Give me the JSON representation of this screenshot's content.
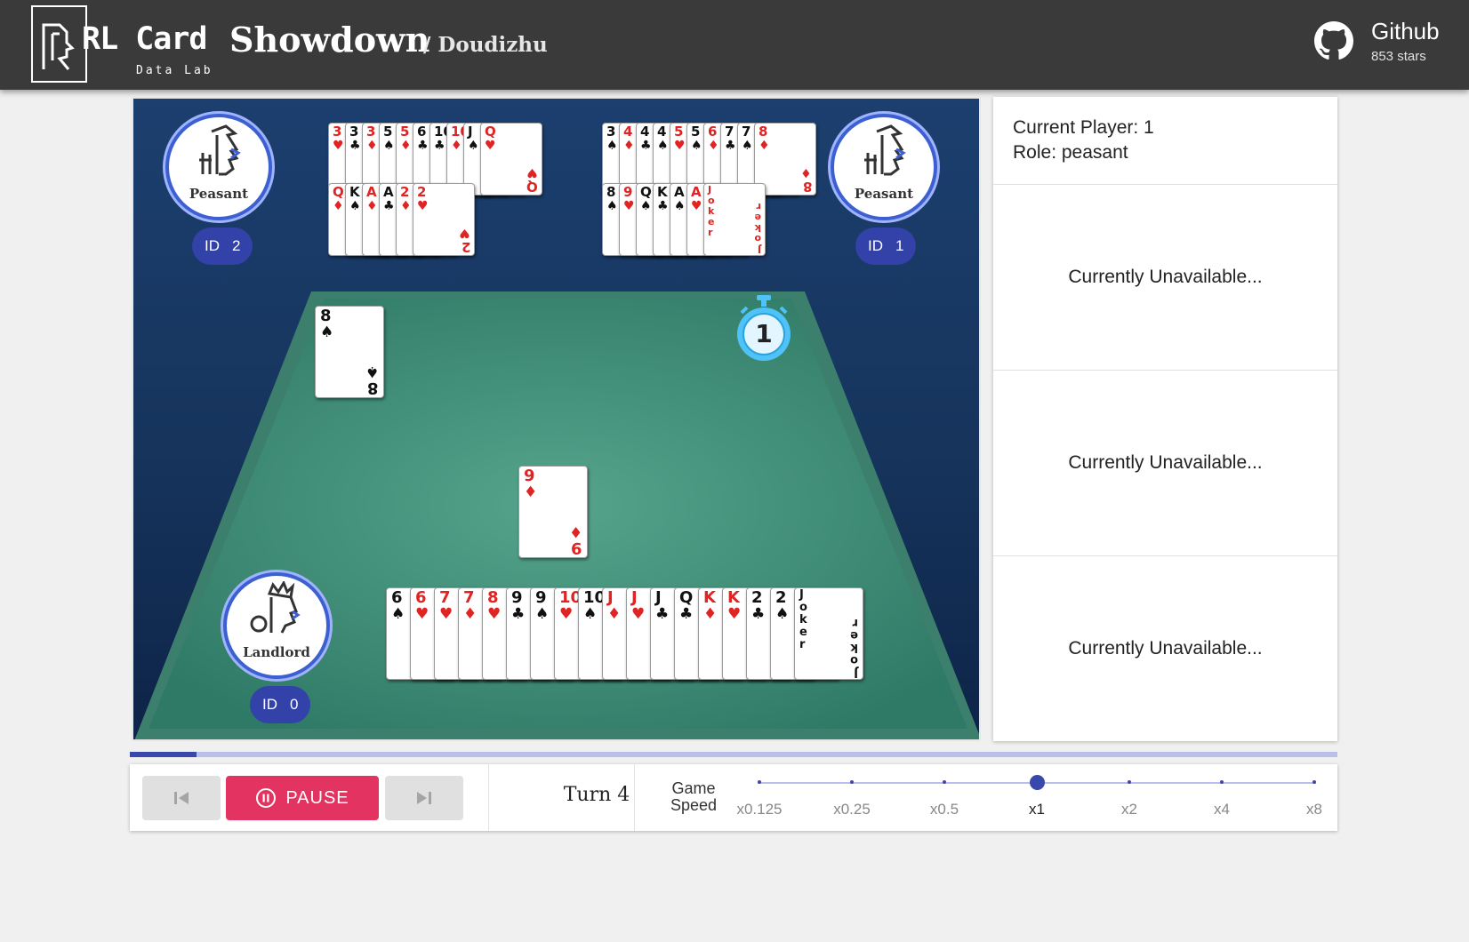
{
  "header": {
    "brand_title": "RL Card",
    "brand_word": "Showdown",
    "brand_sub": "Data Lab",
    "game_name": "/ Doudizhu",
    "github_label": "Github",
    "github_stars": "853 stars"
  },
  "players": [
    {
      "role": "Peasant",
      "id_prefix": "ID",
      "id": "2"
    },
    {
      "role": "Peasant",
      "id_prefix": "ID",
      "id": "1"
    },
    {
      "role": "Landlord",
      "id_prefix": "ID",
      "id": "0"
    }
  ],
  "timer": {
    "value": "1"
  },
  "hands": {
    "player2_row1": [
      {
        "rank": "3",
        "suit": "♥",
        "color": "red"
      },
      {
        "rank": "3",
        "suit": "♣",
        "color": "black"
      },
      {
        "rank": "3",
        "suit": "♦",
        "color": "red"
      },
      {
        "rank": "5",
        "suit": "♠",
        "color": "black"
      },
      {
        "rank": "5",
        "suit": "♦",
        "color": "red"
      },
      {
        "rank": "6",
        "suit": "♣",
        "color": "black"
      },
      {
        "rank": "10",
        "suit": "♣",
        "color": "black"
      },
      {
        "rank": "10",
        "suit": "♦",
        "color": "red"
      },
      {
        "rank": "J",
        "suit": "♠",
        "color": "black"
      },
      {
        "rank": "Q",
        "suit": "♥",
        "color": "red"
      }
    ],
    "player2_row2": [
      {
        "rank": "Q",
        "suit": "♦",
        "color": "red"
      },
      {
        "rank": "K",
        "suit": "♠",
        "color": "black"
      },
      {
        "rank": "A",
        "suit": "♦",
        "color": "red"
      },
      {
        "rank": "A",
        "suit": "♣",
        "color": "black"
      },
      {
        "rank": "2",
        "suit": "♦",
        "color": "red"
      },
      {
        "rank": "2",
        "suit": "♥",
        "color": "red"
      }
    ],
    "player1_row1": [
      {
        "rank": "3",
        "suit": "♠",
        "color": "black"
      },
      {
        "rank": "4",
        "suit": "♦",
        "color": "red"
      },
      {
        "rank": "4",
        "suit": "♣",
        "color": "black"
      },
      {
        "rank": "4",
        "suit": "♠",
        "color": "black"
      },
      {
        "rank": "5",
        "suit": "♥",
        "color": "red"
      },
      {
        "rank": "5",
        "suit": "♠",
        "color": "black"
      },
      {
        "rank": "6",
        "suit": "♦",
        "color": "red"
      },
      {
        "rank": "7",
        "suit": "♣",
        "color": "black"
      },
      {
        "rank": "7",
        "suit": "♠",
        "color": "black"
      },
      {
        "rank": "8",
        "suit": "♦",
        "color": "red"
      }
    ],
    "player1_row2": [
      {
        "rank": "8",
        "suit": "♠",
        "color": "black"
      },
      {
        "rank": "9",
        "suit": "♥",
        "color": "red"
      },
      {
        "rank": "Q",
        "suit": "♠",
        "color": "black"
      },
      {
        "rank": "K",
        "suit": "♣",
        "color": "black"
      },
      {
        "rank": "A",
        "suit": "♠",
        "color": "black"
      },
      {
        "rank": "A",
        "suit": "♥",
        "color": "red"
      },
      {
        "rank": "Joker",
        "suit": "",
        "color": "red",
        "joker": true
      }
    ],
    "player0": [
      {
        "rank": "6",
        "suit": "♠",
        "color": "black"
      },
      {
        "rank": "6",
        "suit": "♥",
        "color": "red"
      },
      {
        "rank": "7",
        "suit": "♥",
        "color": "red"
      },
      {
        "rank": "7",
        "suit": "♦",
        "color": "red"
      },
      {
        "rank": "8",
        "suit": "♥",
        "color": "red"
      },
      {
        "rank": "9",
        "suit": "♣",
        "color": "black"
      },
      {
        "rank": "9",
        "suit": "♠",
        "color": "black"
      },
      {
        "rank": "10",
        "suit": "♥",
        "color": "red"
      },
      {
        "rank": "10",
        "suit": "♠",
        "color": "black"
      },
      {
        "rank": "J",
        "suit": "♦",
        "color": "red"
      },
      {
        "rank": "J",
        "suit": "♥",
        "color": "red"
      },
      {
        "rank": "J",
        "suit": "♣",
        "color": "black"
      },
      {
        "rank": "Q",
        "suit": "♣",
        "color": "black"
      },
      {
        "rank": "K",
        "suit": "♦",
        "color": "red"
      },
      {
        "rank": "K",
        "suit": "♥",
        "color": "red"
      },
      {
        "rank": "2",
        "suit": "♣",
        "color": "black"
      },
      {
        "rank": "2",
        "suit": "♠",
        "color": "black"
      },
      {
        "rank": "Joker",
        "suit": "",
        "color": "black",
        "joker": true
      }
    ]
  },
  "played": {
    "player2": {
      "rank": "8",
      "suit": "♠",
      "color": "black"
    },
    "player0": {
      "rank": "9",
      "suit": "♦",
      "color": "red"
    }
  },
  "panel": {
    "current_player": "Current Player: 1",
    "role": "Role: peasant",
    "sections": [
      "Currently Unavailable...",
      "Currently Unavailable...",
      "Currently Unavailable..."
    ]
  },
  "progress": {
    "fraction": 0.055
  },
  "controls": {
    "prev_icon": "skip-previous-icon",
    "pause_label": "PAUSE",
    "pause_icon": "pause-circle-icon",
    "next_icon": "skip-next-icon",
    "turn": "Turn 4",
    "speed_label_1": "Game",
    "speed_label_2": "Speed",
    "speeds": [
      "x0.125",
      "x0.25",
      "x0.5",
      "x1",
      "x2",
      "x4",
      "x8"
    ],
    "selected_speed": "x1"
  },
  "colors": {
    "appbar": "#3a3a3a",
    "accent": "#3949ab",
    "pause": "#e33360",
    "table": "#3f8a74",
    "board": "#1c3f6f"
  }
}
